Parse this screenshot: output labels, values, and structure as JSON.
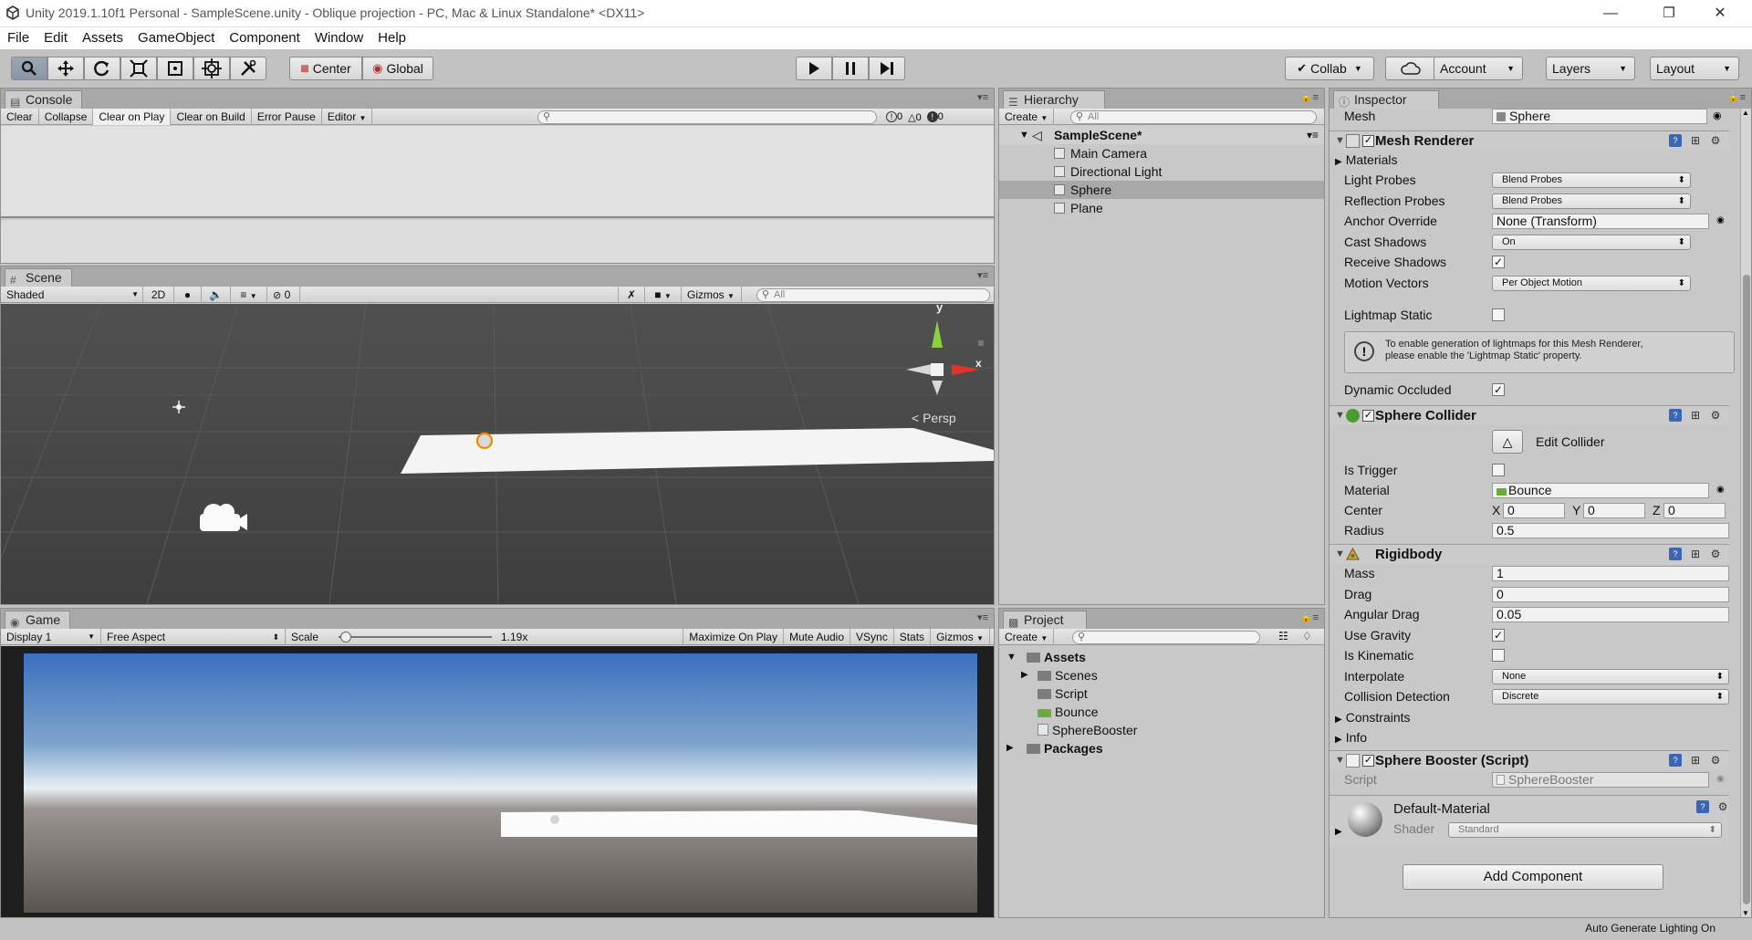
{
  "window": {
    "title": "Unity 2019.1.10f1 Personal - SampleScene.unity - Oblique projection - PC, Mac & Linux Standalone* <DX11>",
    "minimize": "—",
    "maximize": "❐",
    "close": "✕"
  },
  "menu": [
    "File",
    "Edit",
    "Assets",
    "GameObject",
    "Component",
    "Window",
    "Help"
  ],
  "toolbar": {
    "pivot": "Center",
    "space": "Global",
    "collab": "Collab",
    "account": "Account",
    "layers": "Layers",
    "layout": "Layout"
  },
  "console": {
    "tab": "Console",
    "buttons": [
      "Clear",
      "Collapse",
      "Clear on Play",
      "Clear on Build",
      "Error Pause",
      "Editor"
    ],
    "log_count": "0",
    "warn_count": "0",
    "error_count": "0"
  },
  "scene": {
    "tab": "Scene",
    "shading": "Shaded",
    "mode_2d": "2D",
    "hidden_count": "0",
    "gizmos": "Gizmos",
    "search_placeholder": "All",
    "gizmo_y": "y",
    "gizmo_x": "x",
    "persp": "Persp"
  },
  "game": {
    "tab": "Game",
    "display": "Display 1",
    "aspect": "Free Aspect",
    "scale_label": "Scale",
    "scale_value": "1.19x",
    "scale_fraction": 0.05,
    "buttons": [
      "Maximize On Play",
      "Mute Audio",
      "VSync",
      "Stats",
      "Gizmos"
    ]
  },
  "hierarchy": {
    "tab": "Hierarchy",
    "create": "Create",
    "search_placeholder": "All",
    "scene_name": "SampleScene*",
    "items": [
      "Main Camera",
      "Directional Light",
      "Sphere",
      "Plane"
    ],
    "selected": "Sphere"
  },
  "project": {
    "tab": "Project",
    "create": "Create",
    "assets": "Assets",
    "asset_items": [
      "Scenes",
      "Script",
      "Bounce",
      "SphereBooster"
    ],
    "packages": "Packages"
  },
  "inspector": {
    "tab": "Inspector",
    "mesh_label": "Mesh",
    "mesh_value": "Sphere",
    "mesh_renderer": {
      "title": "Mesh Renderer",
      "materials": "Materials",
      "light_probes_label": "Light Probes",
      "light_probes_value": "Blend Probes",
      "reflection_probes_label": "Reflection Probes",
      "reflection_probes_value": "Blend Probes",
      "anchor_override_label": "Anchor Override",
      "anchor_override_value": "None (Transform)",
      "cast_shadows_label": "Cast Shadows",
      "cast_shadows_value": "On",
      "receive_shadows_label": "Receive Shadows",
      "motion_vectors_label": "Motion Vectors",
      "motion_vectors_value": "Per Object Motion",
      "lightmap_static_label": "Lightmap Static",
      "info_text_1": "To enable generation of lightmaps for this Mesh Renderer,",
      "info_text_2": "please enable the 'Lightmap Static' property.",
      "dynamic_occluded_label": "Dynamic Occluded"
    },
    "sphere_collider": {
      "title": "Sphere Collider",
      "edit_collider": "Edit Collider",
      "is_trigger_label": "Is Trigger",
      "material_label": "Material",
      "material_value": "Bounce",
      "center_label": "Center",
      "x_label": "X",
      "x_value": "0",
      "y_label": "Y",
      "y_value": "0",
      "z_label": "Z",
      "z_value": "0",
      "radius_label": "Radius",
      "radius_value": "0.5"
    },
    "rigidbody": {
      "title": "Rigidbody",
      "mass_label": "Mass",
      "mass_value": "1",
      "drag_label": "Drag",
      "drag_value": "0",
      "angular_drag_label": "Angular Drag",
      "angular_drag_value": "0.05",
      "use_gravity_label": "Use Gravity",
      "is_kinematic_label": "Is Kinematic",
      "interpolate_label": "Interpolate",
      "interpolate_value": "None",
      "collision_label": "Collision Detection",
      "collision_value": "Discrete",
      "constraints": "Constraints",
      "info": "Info"
    },
    "sphere_booster": {
      "title": "Sphere Booster (Script)",
      "script_label": "Script",
      "script_value": "SphereBooster"
    },
    "material": {
      "name": "Default-Material",
      "shader_label": "Shader",
      "shader_value": "Standard"
    },
    "add_component": "Add Component"
  },
  "status": {
    "text": "Auto Generate Lighting On"
  },
  "checks": {
    "receive_shadows": true,
    "lightmap_static": false,
    "dynamic_occluded": true,
    "is_trigger": false,
    "use_gravity": true,
    "is_kinematic": false
  },
  "colors": {
    "editor_bg": "#c2c2c2",
    "selection": "#a8a8a8",
    "scene_bg": "#474747",
    "accent_blue": "#3a66b5"
  }
}
